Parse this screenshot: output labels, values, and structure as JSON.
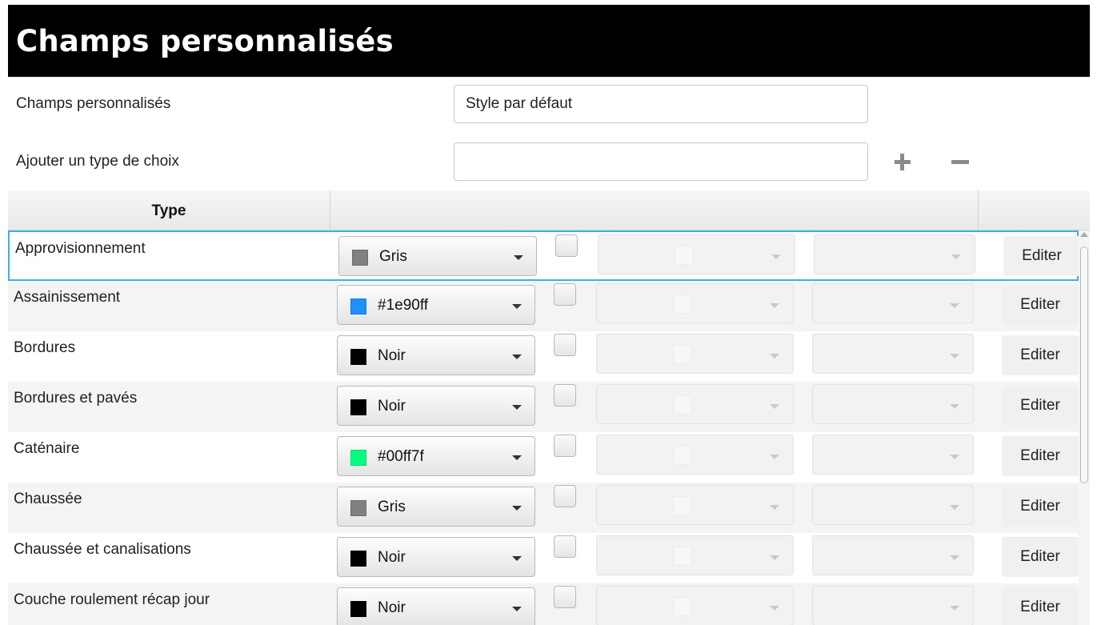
{
  "window": {
    "title": "Champs personnalisés"
  },
  "form": {
    "style_label": "Champs personnalisés",
    "style_value": "Style par défaut",
    "choice_label": "Ajouter un type de choix",
    "choice_value": "",
    "add_icon": "plus-icon",
    "remove_icon": "minus-icon"
  },
  "table": {
    "header": {
      "type": "Type"
    },
    "edit_label": "Editer",
    "rows": [
      {
        "type": "Approvisionnement",
        "color_label": "Gris",
        "color": "#808080"
      },
      {
        "type": "Assainissement",
        "color_label": "#1e90ff",
        "color": "#1e90ff"
      },
      {
        "type": "Bordures",
        "color_label": "Noir",
        "color": "#000000"
      },
      {
        "type": "Bordures et pavés",
        "color_label": "Noir",
        "color": "#000000"
      },
      {
        "type": "Caténaire",
        "color_label": "#00ff7f",
        "color": "#00ff7f"
      },
      {
        "type": "Chaussée",
        "color_label": "Gris",
        "color": "#808080"
      },
      {
        "type": "Chaussée et canalisations",
        "color_label": "Noir",
        "color": "#000000"
      },
      {
        "type": "Couche roulement récap jour",
        "color_label": "Noir",
        "color": "#000000"
      }
    ]
  },
  "colors": {
    "accent": "#3fb2d6",
    "title_bg": "#000000"
  }
}
